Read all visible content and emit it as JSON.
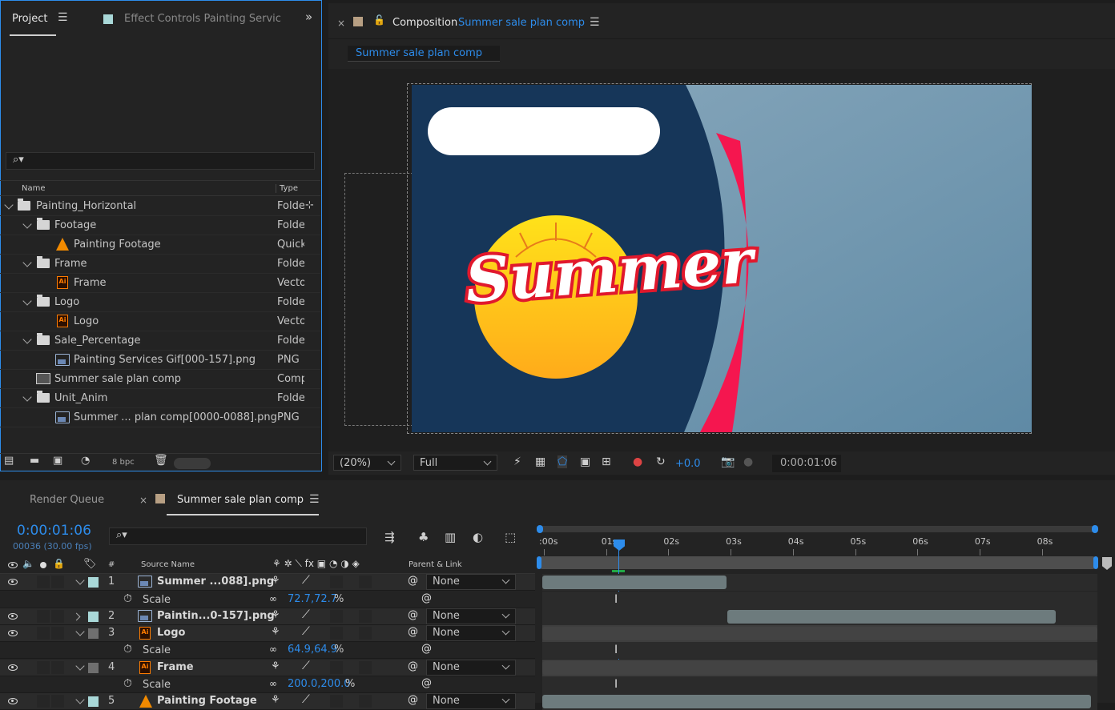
{
  "project_panel": {
    "tab_project": "Project",
    "tab_effect_controls": "Effect Controls Painting Services",
    "search_placeholder": "",
    "col_name": "Name",
    "col_type": "Type",
    "bpc": "8 bpc",
    "items": [
      {
        "name": "Painting_Horizontal",
        "type": "Folde",
        "icon": "folder-icon"
      },
      {
        "name": "Footage",
        "type": "Folde",
        "icon": "folder-icon"
      },
      {
        "name": "Painting Footage",
        "type": "Quick",
        "icon": "vlc-cone-icon"
      },
      {
        "name": "Frame",
        "type": "Folde",
        "icon": "folder-icon"
      },
      {
        "name": "Frame",
        "type": "Vecto",
        "icon": "illustrator-file-icon"
      },
      {
        "name": "Logo",
        "type": "Folde",
        "icon": "folder-icon"
      },
      {
        "name": "Logo",
        "type": "Vecto",
        "icon": "illustrator-file-icon"
      },
      {
        "name": "Sale_Percentage",
        "type": "Folde",
        "icon": "folder-icon"
      },
      {
        "name": "Painting Services Gif[000-157].png",
        "type": "PNG",
        "icon": "image-sequence-icon"
      },
      {
        "name": "Summer sale plan comp",
        "type": "Comp",
        "icon": "composition-icon"
      },
      {
        "name": "Unit_Anim",
        "type": "Folde",
        "icon": "folder-icon"
      },
      {
        "name": "Summer ... plan comp[0000-0088].png",
        "type": "PNG",
        "icon": "image-sequence-icon"
      }
    ]
  },
  "viewer": {
    "tab_prefix": "Composition",
    "tab_comp_name": "Summer sale plan comp",
    "breadcrumb": "Summer sale plan comp",
    "artwork_text": "Summer",
    "zoom": "(20%)",
    "resolution": "Full",
    "exposure": "+0.0",
    "timecode": "0:00:01:06"
  },
  "timeline": {
    "tab_render_queue": "Render Queue",
    "tab_comp": "Summer sale plan comp",
    "timecode": "0:00:01:06",
    "frame_info": "00036 (30.00 fps)",
    "col_hash": "#",
    "col_source": "Source Name",
    "col_parent": "Parent & Link",
    "ruler_ticks": [
      ":00s",
      "01s",
      "02s",
      "03s",
      "04s",
      "05s",
      "06s",
      "07s",
      "08s"
    ],
    "layers": [
      {
        "num": "1",
        "name": "Summer ...088].png",
        "parent": "None",
        "color": "#a9d8d8",
        "expanded": true,
        "icon": "image-sequence-icon"
      },
      {
        "num": "2",
        "name": "Paintin...0-157].png",
        "parent": "None",
        "color": "#a9d8d8",
        "expanded": false,
        "icon": "image-sequence-icon"
      },
      {
        "num": "3",
        "name": "Logo",
        "parent": "None",
        "color": "#6f6f6f",
        "expanded": true,
        "icon": "illustrator-file-icon"
      },
      {
        "num": "4",
        "name": "Frame",
        "parent": "None",
        "color": "#6f6f6f",
        "expanded": true,
        "icon": "illustrator-file-icon"
      },
      {
        "num": "5",
        "name": "Painting Footage",
        "parent": "None",
        "color": "#a9d8d8",
        "expanded": true,
        "icon": "vlc-cone-icon"
      }
    ],
    "scale_rows": [
      {
        "label": "Scale",
        "value_a": "72.7,72.7",
        "unit": "%"
      },
      {
        "label": "Scale",
        "value_a": "64.9,64.9",
        "unit": "%"
      },
      {
        "label": "Scale",
        "value_a": "200.0,200.0",
        "unit": "%"
      }
    ]
  },
  "colors": {
    "accent": "#2d8ceb",
    "panel": "#232323",
    "navy": "#163659",
    "pink": "#f5164f",
    "sky": "#6b91aa"
  }
}
